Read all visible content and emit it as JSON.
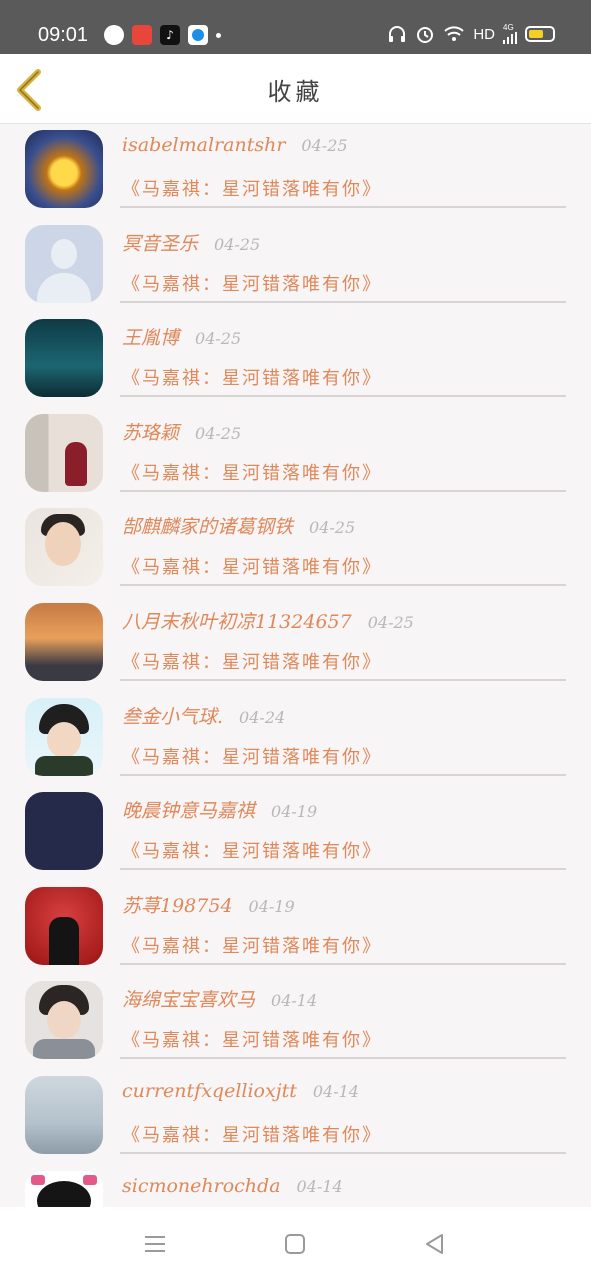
{
  "status_bar": {
    "time": "09:01",
    "network_label": "HD",
    "signal_label": "4G",
    "icons": [
      "globe-icon",
      "app-icon-red",
      "tiktok-icon",
      "app-icon-blue",
      "headphones-icon",
      "alarm-icon",
      "wifi-icon",
      "signal-icon",
      "battery-icon"
    ]
  },
  "header": {
    "title": "收藏",
    "back_icon": "chevron-left-icon"
  },
  "colors": {
    "accent": "#e0885a",
    "back_icon": "#d6b23a",
    "date": "#b8b8b8"
  },
  "list": [
    {
      "name": "isabelmalrantshr",
      "date": "04-25",
      "work": "《马嘉祺：星河错落唯有你》"
    },
    {
      "name": "冥音圣乐",
      "date": "04-25",
      "work": "《马嘉祺：星河错落唯有你》"
    },
    {
      "name": "王胤博",
      "date": "04-25",
      "work": "《马嘉祺：星河错落唯有你》"
    },
    {
      "name": "苏珞颖",
      "date": "04-25",
      "work": "《马嘉祺：星河错落唯有你》"
    },
    {
      "name": "郜麒麟家的诸葛钢铁",
      "date": "04-25",
      "work": "《马嘉祺：星河错落唯有你》"
    },
    {
      "name": "八月末秋叶初凉11324657",
      "date": "04-25",
      "work": "《马嘉祺：星河错落唯有你》"
    },
    {
      "name": "叁金小气球.",
      "date": "04-24",
      "work": "《马嘉祺：星河错落唯有你》"
    },
    {
      "name": "晚晨钟意马嘉祺",
      "date": "04-19",
      "work": "《马嘉祺：星河错落唯有你》"
    },
    {
      "name": "苏荨198754",
      "date": "04-19",
      "work": "《马嘉祺：星河错落唯有你》"
    },
    {
      "name": "海绵宝宝喜欢马",
      "date": "04-14",
      "work": "《马嘉祺：星河错落唯有你》"
    },
    {
      "name": "currentfxqellioxjtt",
      "date": "04-14",
      "work": "《马嘉祺：星河错落唯有你》"
    },
    {
      "name": "sicmonehrochda",
      "date": "04-14",
      "work": ""
    }
  ],
  "nav_bar": {
    "icons": [
      "menu-icon",
      "home-square-icon",
      "back-triangle-icon"
    ]
  }
}
